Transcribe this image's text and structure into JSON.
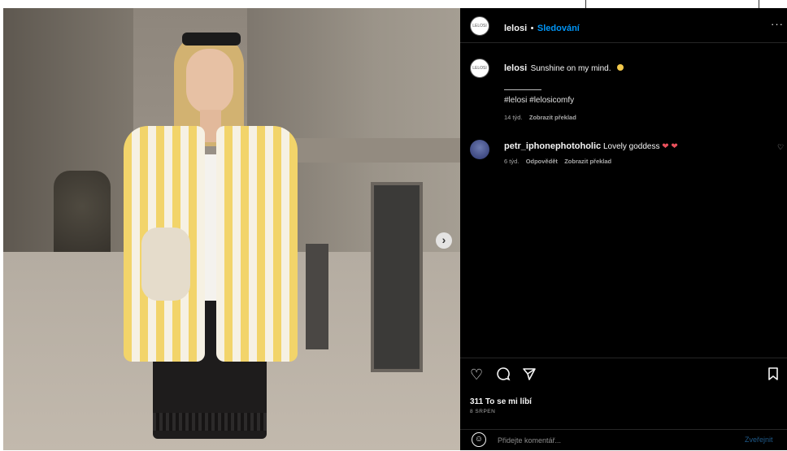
{
  "top_strip": {
    "cut_text": ""
  },
  "post": {
    "author": {
      "username": "lelosi",
      "separator": "•",
      "follow_label": "Sledování",
      "more_label": "···",
      "avatar_text": "LELOSI"
    },
    "caption": {
      "username": "lelosi",
      "text": "Sunshine on my mind.",
      "hashtags": "#lelosi #lelosicomfy",
      "age": "14 týd.",
      "translate_label": "Zobrazit překlad"
    },
    "comments": [
      {
        "username": "petr_iphonephotoholic",
        "text": "Lovely goddess",
        "emoji": "❤ ❤",
        "age": "6 týd.",
        "reply_label": "Odpovědět",
        "translate_label": "Zobrazit překlad"
      }
    ],
    "likes_text": "311 To se mi líbí",
    "date_text": "8 SRPEN",
    "comment_placeholder": "Přidejte komentář...",
    "post_label": "Zveřejnit"
  },
  "icons": {
    "like": "heart-icon",
    "comment": "comment-icon",
    "share": "send-icon",
    "save": "bookmark-icon",
    "next": "chevron-right-icon",
    "emoji": "emoji-icon"
  },
  "colors": {
    "accent": "#0095f6",
    "background": "#000000",
    "heart": "#e8505b"
  }
}
